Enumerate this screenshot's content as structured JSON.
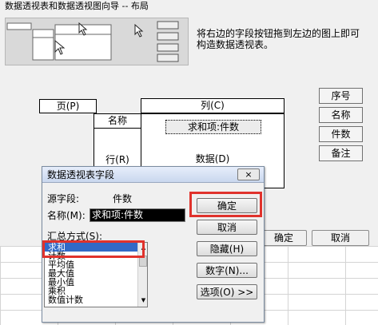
{
  "wizard": {
    "title": "数据透视表和数据透视图向导 -- 布局",
    "instruction": "将右边的字段按钮拖到左边的图上即可构造数据透视表。",
    "page_label": "页(P)",
    "column_label": "列(C)",
    "row_label": "行(R)",
    "data_label": "数据(D)",
    "row_field": "名称",
    "data_field": "求和项:件数",
    "field_buttons": [
      "序号",
      "名称",
      "件数",
      "备注"
    ],
    "ok_label": "确定",
    "cancel_label": "取消"
  },
  "dialog": {
    "title": "数据透视表字段",
    "close_icon": "×",
    "source_label": "源字段:",
    "source_value": "件数",
    "name_label": "名称(M):",
    "name_value": "求和项:件数",
    "summary_label": "汇总方式(S):",
    "summary_options": [
      "求和",
      "计数",
      "平均值",
      "最大值",
      "最小值",
      "乘积",
      "数值计数"
    ],
    "selected_option": "求和",
    "buttons": {
      "ok": "确定",
      "cancel": "取消",
      "hide": "隐藏(H)",
      "number": "数字(N)...",
      "options": "选项(O) >>"
    }
  },
  "colors": {
    "highlight_frame": "#e0322c",
    "selection": "#3169c6"
  }
}
